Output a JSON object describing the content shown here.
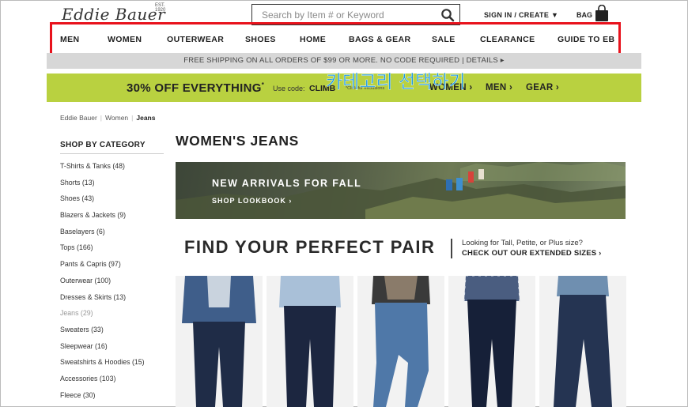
{
  "header": {
    "logo": "Eddie Bauer",
    "logo_est": "EST. 1920",
    "search_placeholder": "Search by Item # or Keyword",
    "sign_in": "SIGN IN / CREATE ▼",
    "bag": "BAG"
  },
  "nav": {
    "items": [
      "MEN",
      "WOMEN",
      "OUTERWEAR",
      "SHOES",
      "HOME",
      "BAGS & GEAR",
      "SALE",
      "CLEARANCE",
      "GUIDE TO EB"
    ]
  },
  "shipping_bar": "FREE SHIPPING ON ALL ORDERS OF $99 OR MORE. NO CODE REQUIRED | DETAILS ▸",
  "promo": {
    "headline": "30% OFF EVERYTHING",
    "headline_mark": "*",
    "code_label": "Use code:",
    "code": "CLIMB",
    "exclusions": "*Click for exclusions",
    "links": [
      "WOMEN ›",
      "MEN ›",
      "GEAR ›"
    ]
  },
  "annotation_overlay": "카테고리 선택하기",
  "breadcrumb": {
    "items": [
      "Eddie Bauer",
      "Women"
    ],
    "current": "Jeans"
  },
  "sidebar": {
    "heading": "SHOP BY CATEGORY",
    "items": [
      "T-Shirts & Tanks (48)",
      "Shorts (13)",
      "Shoes (43)",
      "Blazers & Jackets (9)",
      "Baselayers (6)",
      "Tops (166)",
      "Pants & Capris (97)",
      "Outerwear (100)",
      "Dresses & Skirts (13)",
      "Jeans (29)",
      "Sweaters (33)",
      "Sleepwear (16)",
      "Sweatshirts & Hoodies (15)",
      "Accessories (103)",
      "Fleece (30)"
    ],
    "current_index": 9
  },
  "main": {
    "page_title": "WOMEN'S JEANS",
    "hero": {
      "title": "NEW ARRIVALS FOR FALL",
      "link": "SHOP LOOKBOOK ›"
    },
    "find_pair": {
      "title": "FIND YOUR PERFECT PAIR",
      "question": "Looking for Tall, Petite, or Plus size?",
      "link": "CHECK OUT OUR EXTENDED SIZES ›"
    }
  },
  "colors": {
    "promo_green": "#b9d140",
    "highlight_red": "#e8121c",
    "overlay_blue": "#1e9be0",
    "shipping_bar_gray": "#d7d7d7"
  }
}
